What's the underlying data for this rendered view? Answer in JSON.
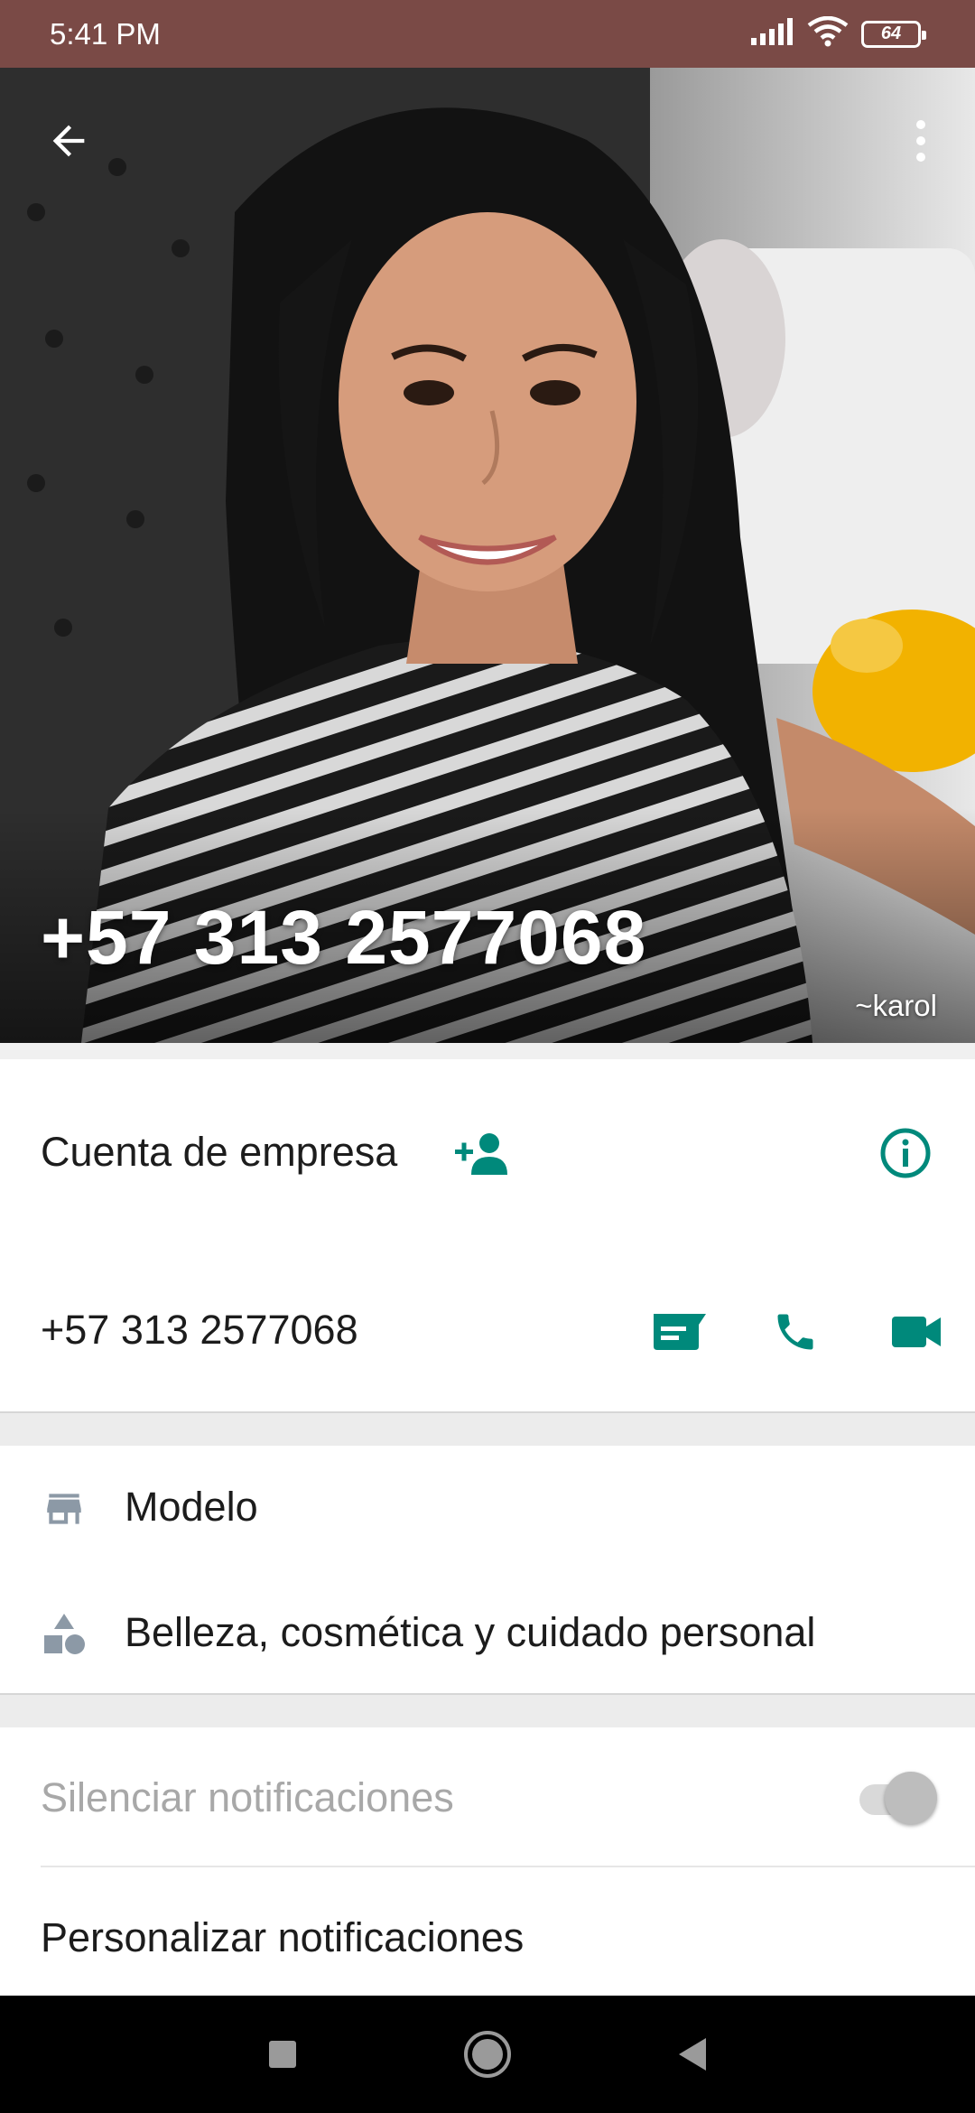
{
  "status_bar": {
    "time": "5:41 PM",
    "battery_level": "64",
    "icons": [
      "signal-icon",
      "wifi-icon",
      "battery-icon"
    ]
  },
  "profile": {
    "title": "+57 313 2577068",
    "push_name": "~karol",
    "account_type_label": "Cuenta de empresa",
    "phone": "+57 313 2577068"
  },
  "business": {
    "items": [
      {
        "icon": "store-icon",
        "label": "Modelo"
      },
      {
        "icon": "category-icon",
        "label": "Belleza, cosmética y cuidado personal"
      }
    ]
  },
  "settings": {
    "mute_label": "Silenciar notificaciones",
    "mute_enabled": false,
    "custom_notifications_label": "Personalizar notificaciones"
  },
  "colors": {
    "status_bar": "#7a4a46",
    "accent": "#00897b",
    "text": "#1c1c1c",
    "muted_text": "#a8a8a8"
  }
}
